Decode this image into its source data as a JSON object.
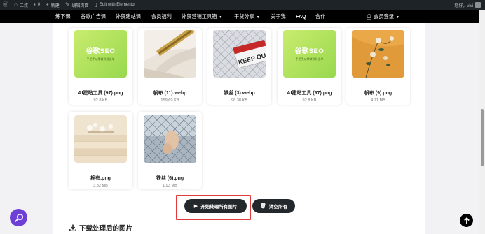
{
  "adminbar": {
    "site_name": "二叔",
    "comments_count": "0",
    "new_label": "新建",
    "edit_page_label": "编辑页面",
    "elementor_label": "Edit with Elementor",
    "greeting": "您好，vivi"
  },
  "nav": {
    "items": [
      {
        "label": "练下课"
      },
      {
        "label": "谷歌广告课"
      },
      {
        "label": "外贸建站课"
      },
      {
        "label": "会员福利"
      },
      {
        "label": "外贸营销工具箱"
      },
      {
        "label": "干货分享"
      },
      {
        "label": "关于我"
      },
      {
        "label": "FAQ"
      },
      {
        "label": "合作"
      }
    ],
    "member_login": "会员登录"
  },
  "seo_thumb": {
    "title": "谷歌SEO",
    "subtitle": "手把手从零做到月出单"
  },
  "images": [
    {
      "name": "AI建站工具 (97).png",
      "size": "92.8 KB"
    },
    {
      "name": "帆布 (11).webp",
      "size": "159.69 KB"
    },
    {
      "name": "铁丝 (3).webp",
      "size": "98.38 KB"
    },
    {
      "name": "AI建站工具 (97).png",
      "size": "92.8 KB"
    },
    {
      "name": "帆布 (9).png",
      "size": "4.71 MB"
    },
    {
      "name": "棉布.png",
      "size": "3.32 MB"
    },
    {
      "name": "铁丝 (6).png",
      "size": "1.93 MB"
    }
  ],
  "sign_text": "PROHIBITED AREA KEEP OUT",
  "actions": {
    "process_all": "开始处理所有图片",
    "clear_all": "清空所有"
  },
  "download_section": {
    "title": "下载处理后的图片"
  },
  "colors": {
    "highlight": "#e23b3b",
    "accent_purple": "#6e3fd6",
    "seo_green": "#a8de5a"
  }
}
